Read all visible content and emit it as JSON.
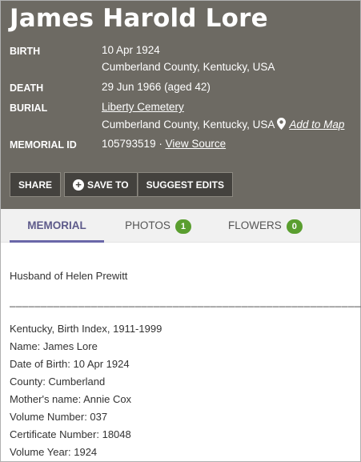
{
  "header": {
    "name": "James Harold Lore",
    "birth_label": "BIRTH",
    "birth_date": "10 Apr 1924",
    "birth_place": "Cumberland County, Kentucky, USA",
    "death_label": "DEATH",
    "death_date": "29 Jun 1966 (aged 42)",
    "burial_label": "BURIAL",
    "burial_cemetery": "Liberty Cemetery",
    "burial_place": "Cumberland County, Kentucky, USA",
    "add_to_map": "Add to Map",
    "memorial_id_label": "MEMORIAL ID",
    "memorial_id": "105793519",
    "separator": " · ",
    "view_source": "View Source"
  },
  "buttons": {
    "share": "SHARE",
    "save_to": "SAVE TO",
    "suggest_edits": "SUGGEST EDITS"
  },
  "tabs": [
    {
      "label": "MEMORIAL",
      "active": true
    },
    {
      "label": "PHOTOS",
      "count": "1"
    },
    {
      "label": "FLOWERS",
      "count": "0"
    }
  ],
  "bio": {
    "spouse_line": "Husband of Helen Prewitt",
    "divider": "______________________________________________________________________",
    "lines": [
      "Kentucky, Birth Index, 1911-1999",
      "Name: James Lore",
      "Date of Birth: 10 Apr 1924",
      "County: Cumberland",
      "Mother's name: Annie Cox",
      "Volume Number: 037",
      "Certificate Number: 18048",
      "Volume Year: 1924"
    ]
  },
  "colors": {
    "header_bg": "#6d6a63",
    "button_bg": "#44423e",
    "tab_active": "#6a67a8",
    "badge_green": "#5a9e2f"
  }
}
